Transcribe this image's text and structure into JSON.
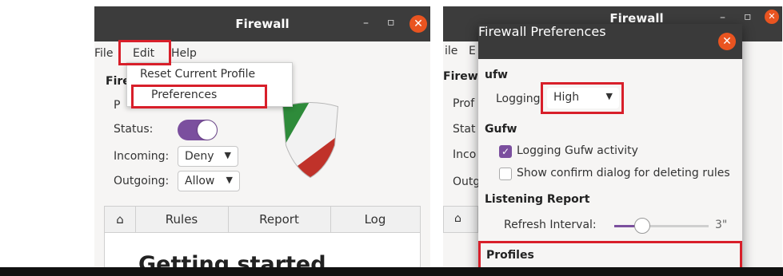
{
  "colors": {
    "accent": "#7b4f9e",
    "close": "#e95420",
    "highlight": "#d81f2a",
    "titlebar": "#3c3c3c"
  },
  "left": {
    "window_title": "Firewall",
    "window_buttons": {
      "minimize": "–",
      "maximize": "▫",
      "close": "✕"
    },
    "menu": {
      "file": "File",
      "edit": "Edit",
      "help": "Help"
    },
    "edit_menu_items": [
      "Reset Current Profile",
      "Preferences"
    ],
    "labels": {
      "firewall": "Fire",
      "profile": "P",
      "status": "Status:",
      "incoming": "Incoming:",
      "outgoing": "Outgoing:"
    },
    "incoming_value": "Deny",
    "outgoing_value": "Allow",
    "status_on": true,
    "tabs": {
      "home_icon": "⌂",
      "rules": "Rules",
      "report": "Report",
      "log": "Log"
    },
    "content_heading": "Getting started",
    "logo_icon": "shield-icon"
  },
  "right": {
    "bg_window_title": "Firewall",
    "bg_window_buttons": {
      "minimize": "–",
      "maximize": "▫",
      "close": "✕"
    },
    "bg_menu": {
      "file": "ile",
      "edit": "E"
    },
    "bg_labels": {
      "firewall": "Firew",
      "profile": "Prof",
      "status": "Stat",
      "incoming": "Inco",
      "outgoing": "Outg"
    },
    "bg_home_icon": "⌂",
    "dialog": {
      "title": "Firewall Preferences",
      "close": "✕",
      "ufw_section": "ufw",
      "logging_label": "Logging:",
      "logging_value": "High",
      "gufw_section": "Gufw",
      "logging_gufw_label": "Logging Gufw activity",
      "logging_gufw_checked": true,
      "confirm_label": "Show confirm dialog for deleting rules",
      "confirm_checked": false,
      "listening_section": "Listening Report",
      "refresh_label": "Refresh Interval:",
      "refresh_value": "3\"",
      "refresh_level": 0.3,
      "profiles_section": "Profiles"
    }
  }
}
